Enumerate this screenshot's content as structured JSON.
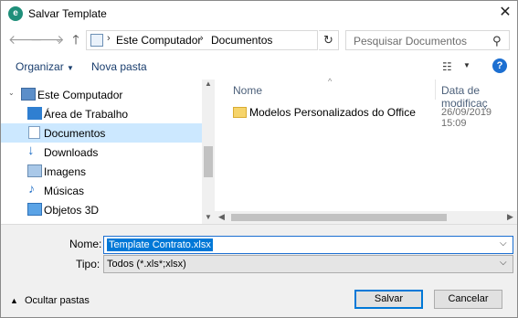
{
  "window": {
    "title": "Salvar Template",
    "app_icon": "app-logo-icon",
    "close_icon": "close-icon"
  },
  "nav": {
    "back_icon": "arrow-left-icon",
    "forward_icon": "arrow-right-icon",
    "recent_icon": "chevron-down-icon",
    "up_icon": "arrow-up-icon",
    "breadcrumb": [
      "Este Computador",
      "Documentos"
    ],
    "search_placeholder": "Pesquisar Documentos"
  },
  "toolbar": {
    "organize_label": "Organizar",
    "new_folder_label": "Nova pasta"
  },
  "sidebar": {
    "items": [
      {
        "label": "Este Computador",
        "icon": "computer-icon",
        "indent": 0,
        "selected": false
      },
      {
        "label": "Área de Trabalho",
        "icon": "desktop-icon",
        "indent": 1,
        "selected": false
      },
      {
        "label": "Documentos",
        "icon": "documents-icon",
        "indent": 1,
        "selected": true
      },
      {
        "label": "Downloads",
        "icon": "downloads-icon",
        "indent": 1,
        "selected": false
      },
      {
        "label": "Imagens",
        "icon": "pictures-icon",
        "indent": 1,
        "selected": false
      },
      {
        "label": "Músicas",
        "icon": "music-icon",
        "indent": 1,
        "selected": false
      },
      {
        "label": "Objetos 3D",
        "icon": "3d-objects-icon",
        "indent": 1,
        "selected": false
      }
    ]
  },
  "file_list": {
    "columns": [
      "Nome",
      "Data de modificaç"
    ],
    "rows": [
      {
        "name": "Modelos Personalizados do Office",
        "date": "26/09/2019 15:09",
        "icon": "folder-icon"
      }
    ]
  },
  "form": {
    "name_label": "Nome:",
    "name_value": "Template Contrato.xlsx",
    "type_label": "Tipo:",
    "type_value": "Todos  (*.xls*;xlsx)",
    "hide_folders_label": "Ocultar pastas",
    "save_label": "Salvar",
    "cancel_label": "Cancelar"
  },
  "colors": {
    "selection": "#cce8ff",
    "accent": "#0078d7",
    "help": "#1c6fd1"
  }
}
